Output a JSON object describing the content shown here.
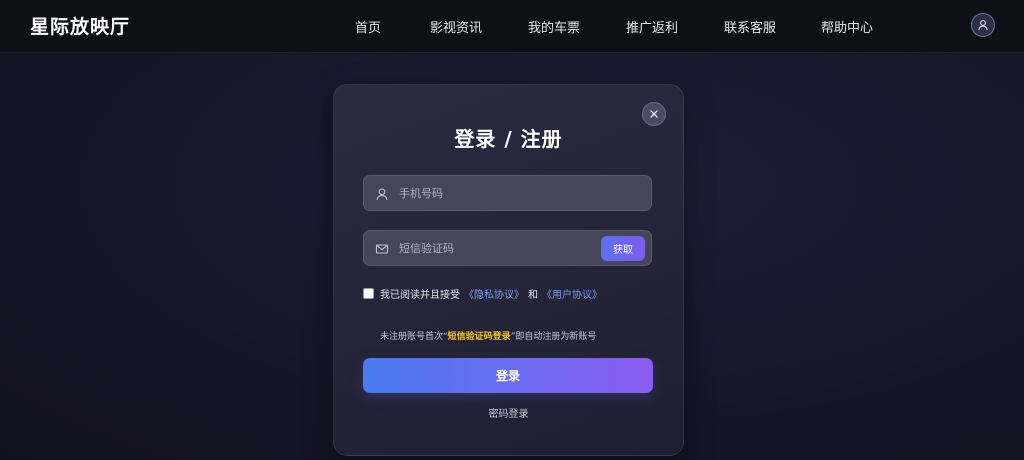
{
  "header": {
    "logo": "星际放映厅",
    "nav": [
      "首页",
      "影视资讯",
      "我的车票",
      "推广返利",
      "联系客服",
      "帮助中心"
    ],
    "avatar_icon": "user-icon"
  },
  "modal": {
    "title": "登录 / 注册",
    "close_icon": "close-icon",
    "phone_placeholder": "手机号码",
    "phone_icon": "user-icon",
    "code_placeholder": "短信验证码",
    "code_icon": "mail-icon",
    "get_code_label": "获取",
    "agree_prefix": "我已阅读并且接受",
    "privacy_link": "《隐私协议》",
    "and_text": "和",
    "user_link": "《用户协议》",
    "hint_prefix": "未注册账号首次“",
    "hint_highlight": "短信验证码登录",
    "hint_suffix": "”即自动注册为新账号",
    "login_label": "登录",
    "password_login_label": "密码登录"
  },
  "colors": {
    "accent_start": "#4a7bf0",
    "accent_end": "#8a5cf0",
    "link": "#7c9cf5",
    "highlight": "#f0c23a"
  }
}
